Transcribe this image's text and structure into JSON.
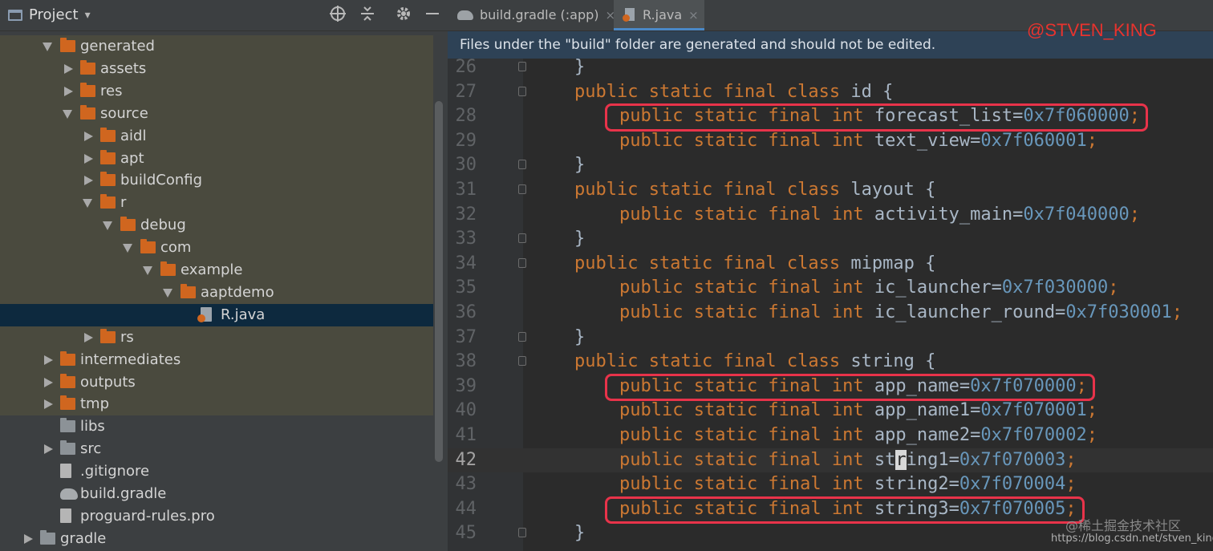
{
  "panel": {
    "title": "Project",
    "title_arrow": "▾",
    "tools": [
      "target-icon",
      "collapse-icon",
      "gear-icon",
      "minimize-icon"
    ]
  },
  "tree": [
    {
      "label": "generated",
      "level": 3,
      "expanded": true,
      "icon": "folder-orange",
      "gen": true
    },
    {
      "label": "assets",
      "level": 4,
      "expanded": false,
      "icon": "folder-orange",
      "gen": true
    },
    {
      "label": "res",
      "level": 4,
      "expanded": false,
      "icon": "folder-orange",
      "gen": true
    },
    {
      "label": "source",
      "level": 4,
      "expanded": true,
      "icon": "folder-orange",
      "gen": true
    },
    {
      "label": "aidl",
      "level": 5,
      "expanded": false,
      "icon": "folder-orange",
      "gen": true
    },
    {
      "label": "apt",
      "level": 5,
      "expanded": false,
      "icon": "folder-orange",
      "gen": true
    },
    {
      "label": "buildConfig",
      "level": 5,
      "expanded": false,
      "icon": "folder-orange",
      "gen": true
    },
    {
      "label": "r",
      "level": 5,
      "expanded": true,
      "icon": "folder-orange",
      "gen": true
    },
    {
      "label": "debug",
      "level": 6,
      "expanded": true,
      "icon": "folder-orange",
      "gen": true
    },
    {
      "label": "com",
      "level": 7,
      "expanded": true,
      "icon": "folder-orange",
      "gen": true
    },
    {
      "label": "example",
      "level": 8,
      "expanded": true,
      "icon": "folder-orange",
      "gen": true
    },
    {
      "label": "aaptdemo",
      "level": 9,
      "expanded": true,
      "icon": "folder-orange",
      "gen": true
    },
    {
      "label": "R.java",
      "level": 10,
      "expanded": null,
      "icon": "java-file",
      "gen": false,
      "selected": true
    },
    {
      "label": "rs",
      "level": 5,
      "expanded": false,
      "icon": "folder-orange",
      "gen": true
    },
    {
      "label": "intermediates",
      "level": 3,
      "expanded": false,
      "icon": "folder-orange",
      "gen": true
    },
    {
      "label": "outputs",
      "level": 3,
      "expanded": false,
      "icon": "folder-orange",
      "gen": true
    },
    {
      "label": "tmp",
      "level": 3,
      "expanded": false,
      "icon": "folder-orange",
      "gen": true
    },
    {
      "label": "libs",
      "level": 3,
      "expanded": null,
      "icon": "folder-gray",
      "gen": false
    },
    {
      "label": "src",
      "level": 3,
      "expanded": false,
      "icon": "folder-gray",
      "gen": false
    },
    {
      "label": ".gitignore",
      "level": 3,
      "expanded": null,
      "icon": "gitignore-file",
      "gen": false
    },
    {
      "label": "build.gradle",
      "level": 3,
      "expanded": null,
      "icon": "gradle-file",
      "gen": false
    },
    {
      "label": "proguard-rules.pro",
      "level": 3,
      "expanded": null,
      "icon": "text-file",
      "gen": false
    },
    {
      "label": "gradle",
      "level": 2,
      "expanded": false,
      "icon": "folder-gray",
      "gen": false
    }
  ],
  "tabs": [
    {
      "label": "build.gradle (:app)",
      "close": "×",
      "active": false,
      "icon": "gradle-elephant-icon"
    },
    {
      "label": "R.java",
      "close": "×",
      "active": true,
      "icon": "java-file-icon"
    }
  ],
  "banner": "Files under the \"build\" folder are generated and should not be edited.",
  "watermark_top": "@STVEN_KING",
  "code_lines": [
    {
      "num": "26",
      "indent": 0,
      "tokens": [
        {
          "t": "}",
          "c": "plain"
        }
      ],
      "fold": true
    },
    {
      "num": "27",
      "indent": 0,
      "tokens": [
        {
          "t": "public static final class ",
          "c": "kw"
        },
        {
          "t": "id {",
          "c": "plain"
        }
      ],
      "fold": true
    },
    {
      "num": "28",
      "indent": 1,
      "tokens": [
        {
          "t": "public static final int ",
          "c": "kw"
        },
        {
          "t": "forecast_list=",
          "c": "plain"
        },
        {
          "t": "0x7f060000",
          "c": "num"
        },
        {
          "t": ";",
          "c": "kw"
        }
      ],
      "fold": false
    },
    {
      "num": "29",
      "indent": 1,
      "tokens": [
        {
          "t": "public static final int ",
          "c": "kw"
        },
        {
          "t": "text_view=",
          "c": "plain"
        },
        {
          "t": "0x7f060001",
          "c": "num"
        },
        {
          "t": ";",
          "c": "kw"
        }
      ],
      "fold": false
    },
    {
      "num": "30",
      "indent": 0,
      "tokens": [
        {
          "t": "}",
          "c": "plain"
        }
      ],
      "fold": true
    },
    {
      "num": "31",
      "indent": 0,
      "tokens": [
        {
          "t": "public static final class ",
          "c": "kw"
        },
        {
          "t": "layout {",
          "c": "plain"
        }
      ],
      "fold": true
    },
    {
      "num": "32",
      "indent": 1,
      "tokens": [
        {
          "t": "public static final int ",
          "c": "kw"
        },
        {
          "t": "activity_main=",
          "c": "plain"
        },
        {
          "t": "0x7f040000",
          "c": "num"
        },
        {
          "t": ";",
          "c": "kw"
        }
      ],
      "fold": false
    },
    {
      "num": "33",
      "indent": 0,
      "tokens": [
        {
          "t": "}",
          "c": "plain"
        }
      ],
      "fold": true
    },
    {
      "num": "34",
      "indent": 0,
      "tokens": [
        {
          "t": "public static final class ",
          "c": "kw"
        },
        {
          "t": "mipmap {",
          "c": "plain"
        }
      ],
      "fold": true
    },
    {
      "num": "35",
      "indent": 1,
      "tokens": [
        {
          "t": "public static final int ",
          "c": "kw"
        },
        {
          "t": "ic_launcher=",
          "c": "plain"
        },
        {
          "t": "0x7f030000",
          "c": "num"
        },
        {
          "t": ";",
          "c": "kw"
        }
      ],
      "fold": false
    },
    {
      "num": "36",
      "indent": 1,
      "tokens": [
        {
          "t": "public static final int ",
          "c": "kw"
        },
        {
          "t": "ic_launcher_round=",
          "c": "plain"
        },
        {
          "t": "0x7f030001",
          "c": "num"
        },
        {
          "t": ";",
          "c": "kw"
        }
      ],
      "fold": false
    },
    {
      "num": "37",
      "indent": 0,
      "tokens": [
        {
          "t": "}",
          "c": "plain"
        }
      ],
      "fold": true
    },
    {
      "num": "38",
      "indent": 0,
      "tokens": [
        {
          "t": "public static final class ",
          "c": "kw"
        },
        {
          "t": "string {",
          "c": "plain"
        }
      ],
      "fold": true
    },
    {
      "num": "39",
      "indent": 1,
      "tokens": [
        {
          "t": "public static final int ",
          "c": "kw"
        },
        {
          "t": "app_name=",
          "c": "plain"
        },
        {
          "t": "0x7f070000",
          "c": "num"
        },
        {
          "t": ";",
          "c": "kw"
        }
      ],
      "fold": false
    },
    {
      "num": "40",
      "indent": 1,
      "tokens": [
        {
          "t": "public static final int ",
          "c": "kw"
        },
        {
          "t": "app_name1=",
          "c": "plain"
        },
        {
          "t": "0x7f070001",
          "c": "num"
        },
        {
          "t": ";",
          "c": "kw"
        }
      ],
      "fold": false
    },
    {
      "num": "41",
      "indent": 1,
      "tokens": [
        {
          "t": "public static final int ",
          "c": "kw"
        },
        {
          "t": "app_name2=",
          "c": "plain"
        },
        {
          "t": "0x7f070002",
          "c": "num"
        },
        {
          "t": ";",
          "c": "kw"
        }
      ],
      "fold": false
    },
    {
      "num": "42",
      "indent": 1,
      "tokens": [
        {
          "t": "public static final int ",
          "c": "kw"
        },
        {
          "t": "st",
          "c": "plain"
        },
        {
          "t": "r",
          "c": "caret"
        },
        {
          "t": "ing1=",
          "c": "plain"
        },
        {
          "t": "0x7f070003",
          "c": "num"
        },
        {
          "t": ";",
          "c": "kw"
        }
      ],
      "fold": false,
      "current": true
    },
    {
      "num": "43",
      "indent": 1,
      "tokens": [
        {
          "t": "public static final int ",
          "c": "kw"
        },
        {
          "t": "string2=",
          "c": "plain"
        },
        {
          "t": "0x7f070004",
          "c": "num"
        },
        {
          "t": ";",
          "c": "kw"
        }
      ],
      "fold": false
    },
    {
      "num": "44",
      "indent": 1,
      "tokens": [
        {
          "t": "public static final int ",
          "c": "kw"
        },
        {
          "t": "string3=",
          "c": "plain"
        },
        {
          "t": "0x7f070005",
          "c": "num"
        },
        {
          "t": ";",
          "c": "kw"
        }
      ],
      "fold": false
    },
    {
      "num": "45",
      "indent": 0,
      "tokens": [
        {
          "t": "}",
          "c": "plain"
        }
      ],
      "fold": true
    }
  ],
  "highlighted_lines": [
    "28",
    "39",
    "44"
  ],
  "watermark_bottom": "@稀土掘金技术社区",
  "watermark_url": "https://blog.csdn.net/stven_king",
  "colors": {
    "keyword": "#cc7832",
    "identifier": "#a9b7c6",
    "number": "#6897bb",
    "highlight_box": "#e8334a",
    "selection": "#0d293e"
  }
}
